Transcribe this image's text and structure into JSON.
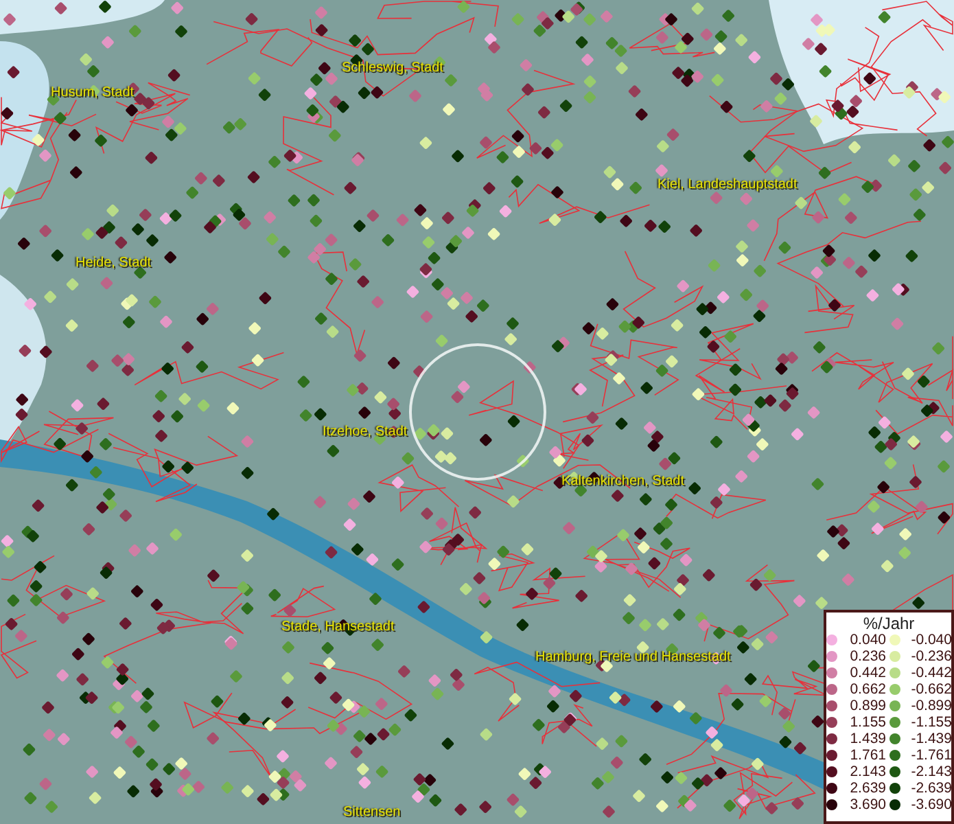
{
  "map": {
    "places": [
      {
        "name": "Schleswig, Stadt"
      },
      {
        "name": "Husum, Stadt"
      },
      {
        "name": "Kiel, Landeshauptstadt"
      },
      {
        "name": "Heide, Stadt"
      },
      {
        "name": "Itzehoe, Stadt"
      },
      {
        "name": "Kaltenkirchen, Stadt"
      },
      {
        "name": "Stade, Hansestadt"
      },
      {
        "name": "Hamburg, Freie und Hansestadt"
      },
      {
        "name": "Sittensen"
      }
    ]
  },
  "legend": {
    "title": "%/Jahr",
    "increase": [
      {
        "label": "0.040",
        "color": "#f4b0e0"
      },
      {
        "label": "0.236",
        "color": "#e396c4"
      },
      {
        "label": "0.442",
        "color": "#d07ea4"
      },
      {
        "label": "0.662",
        "color": "#bc6688"
      },
      {
        "label": "0.899",
        "color": "#a84e6c"
      },
      {
        "label": "1.155",
        "color": "#963e58"
      },
      {
        "label": "1.439",
        "color": "#7e2a42"
      },
      {
        "label": "1.761",
        "color": "#6a1a30"
      },
      {
        "label": "2.143",
        "color": "#540e20"
      },
      {
        "label": "2.639",
        "color": "#3e0614"
      },
      {
        "label": "3.690",
        "color": "#28020a"
      }
    ],
    "decrease": [
      {
        "label": "-0.040",
        "color": "#f0f8b8"
      },
      {
        "label": "-0.236",
        "color": "#d8eca0"
      },
      {
        "label": "-0.442",
        "color": "#b8dc88"
      },
      {
        "label": "-0.662",
        "color": "#98cc6c"
      },
      {
        "label": "-0.899",
        "color": "#78b454"
      },
      {
        "label": "-1.155",
        "color": "#5a9a3c"
      },
      {
        "label": "-1.439",
        "color": "#42842c"
      },
      {
        "label": "-1.761",
        "color": "#2e6e1e"
      },
      {
        "label": "-2.143",
        "color": "#1e5812"
      },
      {
        "label": "-2.639",
        "color": "#12420a"
      },
      {
        "label": "-3.690",
        "color": "#082c04"
      }
    ]
  }
}
